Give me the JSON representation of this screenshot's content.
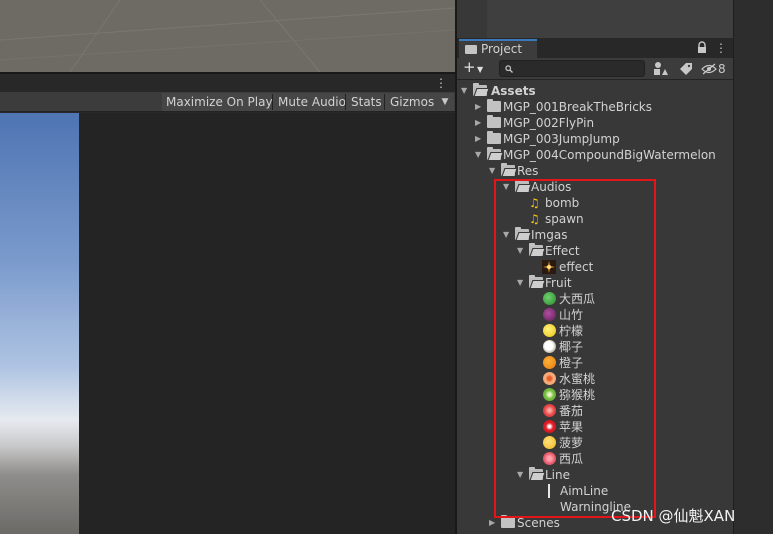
{
  "game_toolbar": {
    "maximize_on_play": "Maximize On Play",
    "mute_audio": "Mute Audio",
    "stats": "Stats",
    "gizmos": "Gizmos"
  },
  "project": {
    "tab_label": "Project",
    "hidden_count": "8",
    "search_placeholder": ""
  },
  "tree": {
    "assets": "Assets",
    "mgp1": "MGP_001BreakTheBricks",
    "mgp2": "MGP_002FlyPin",
    "mgp3": "MGP_003JumpJump",
    "mgp4": "MGP_004CompoundBigWatermelon",
    "res": "Res",
    "audios": "Audios",
    "bomb": "bomb",
    "spawn": "spawn",
    "imgas": "Imgas",
    "effect_folder": "Effect",
    "effect": "effect",
    "fruit_folder": "Fruit",
    "fruits": [
      "大西瓜",
      "山竹",
      "柠檬",
      "椰子",
      "橙子",
      "水蜜桃",
      "猕猴桃",
      "番茄",
      "苹果",
      "菠萝",
      "西瓜"
    ],
    "line_folder": "Line",
    "aimline": "AimLine",
    "warningline": "Warningline",
    "scenes": "Scenes"
  },
  "fruit_colors": [
    "#3aa23a",
    "#7b2e78",
    "#f5d21e",
    "#e9e3d6",
    "#f08a14",
    "#f3a06a",
    "#7ac142",
    "#e84b4b",
    "#e5202a",
    "#f5c534",
    "#e86072"
  ],
  "watermark": "CSDN @仙魁XAN",
  "highlight_color": "#e3151b"
}
